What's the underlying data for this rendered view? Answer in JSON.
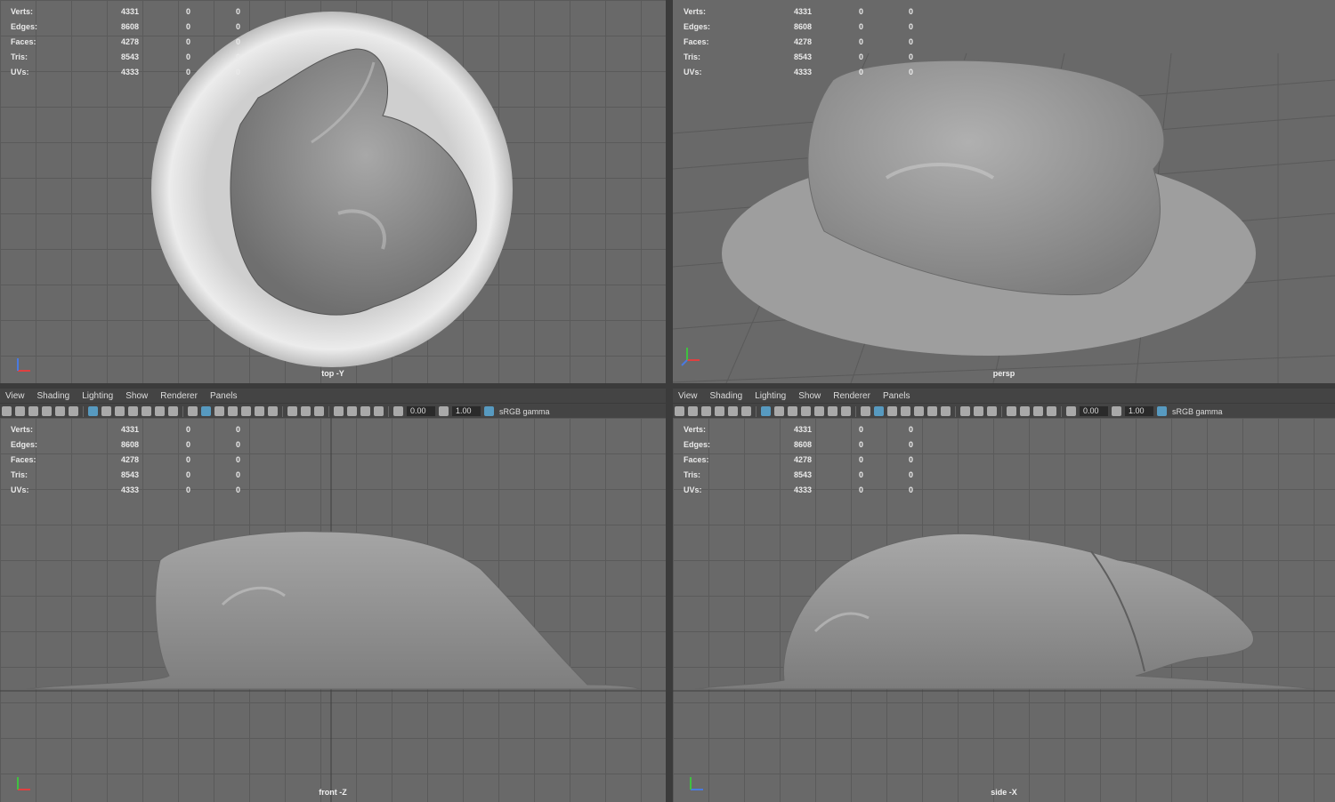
{
  "hud": {
    "rows": [
      {
        "label": "Verts:",
        "v1": "4331",
        "v2": "0",
        "v3": "0"
      },
      {
        "label": "Edges:",
        "v1": "8608",
        "v2": "0",
        "v3": "0"
      },
      {
        "label": "Faces:",
        "v1": "4278",
        "v2": "0",
        "v3": "0"
      },
      {
        "label": "Tris:",
        "v1": "8543",
        "v2": "0",
        "v3": "0"
      },
      {
        "label": "UVs:",
        "v1": "4333",
        "v2": "0",
        "v3": "0"
      }
    ]
  },
  "viewports": {
    "top": {
      "camera": "top -Y"
    },
    "persp": {
      "camera": "persp"
    },
    "front": {
      "camera": "front -Z"
    },
    "side": {
      "camera": "side -X"
    }
  },
  "menu": [
    "View",
    "Shading",
    "Lighting",
    "Show",
    "Renderer",
    "Panels"
  ],
  "toolbar": {
    "exposure": "0.00",
    "gamma": "1.00",
    "colorspace": "sRGB gamma"
  },
  "colors": {
    "viewport_bg": "#696969",
    "grid": "#5a5a5a",
    "panel": "#444444",
    "accent": "#5aa9d6"
  }
}
